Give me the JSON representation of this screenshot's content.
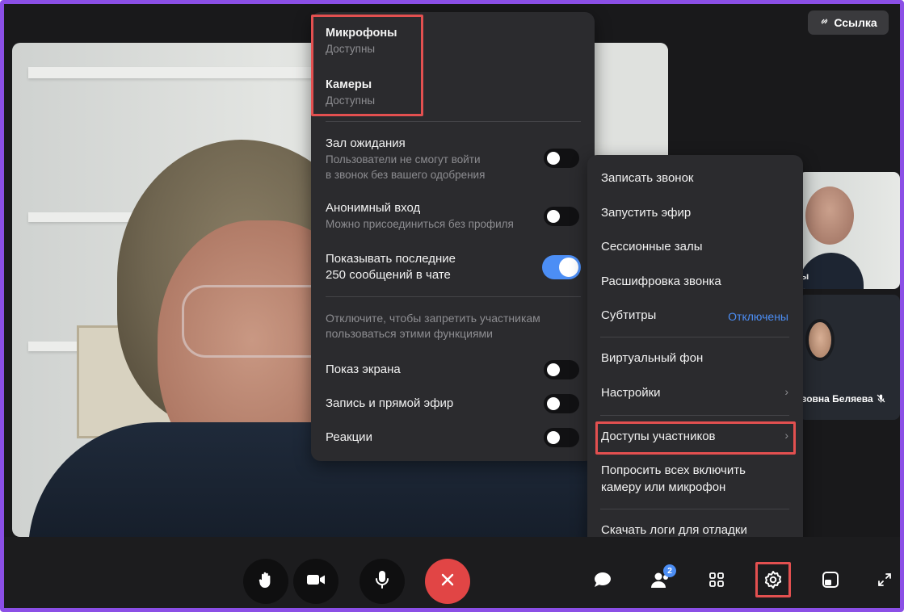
{
  "link_chip": {
    "icon": "link-icon",
    "label": "Ссылка"
  },
  "access_panel": {
    "microphones": {
      "title": "Микрофоны",
      "status": "Доступны"
    },
    "cameras": {
      "title": "Камеры",
      "status": "Доступны"
    },
    "waiting_room": {
      "title": "Зал ожидания",
      "desc_line1": "Пользователи не смогут войти",
      "desc_line2": "в звонок без вашего одобрения",
      "enabled": false
    },
    "anonymous_entry": {
      "title": "Анонимный вход",
      "desc": "Можно присоединиться без профиля",
      "enabled": false
    },
    "show_last_messages": {
      "line1": "Показывать последние",
      "line2": "250 сообщений в чате",
      "enabled": true
    },
    "restrict_note": {
      "line1": "Отключите, чтобы запретить участникам",
      "line2": "пользоваться этими функциями"
    },
    "screen_share": {
      "label": "Показ экрана",
      "enabled": false
    },
    "recording": {
      "label": "Запись и прямой эфир",
      "enabled": false
    },
    "reactions": {
      "label": "Реакции",
      "enabled": false
    }
  },
  "settings_menu": {
    "record_call": "Записать звонок",
    "start_stream": "Запустить эфир",
    "session_rooms": "Сессионные залы",
    "transcription": "Расшифровка звонка",
    "subtitles": {
      "label": "Субтитры",
      "value": "Отключены"
    },
    "virtual_bg": "Виртуальный фон",
    "settings": "Настройки",
    "participant_access": "Доступы участников",
    "ask_enable_line1": "Попросить всех включить",
    "ask_enable_line2": "камеру или микрофон",
    "download_logs": "Скачать логи для отладки"
  },
  "tiles": {
    "tile1_name_fragment": "ы",
    "tile2_name": "вовна Беляева"
  },
  "toolbar": {
    "participants_badge": "2",
    "icons": [
      "raise-hand-icon",
      "camera-icon",
      "microphone-icon",
      "end-call-icon",
      "chat-icon",
      "participants-icon",
      "grid-icon",
      "settings-icon",
      "layout-icon",
      "fullscreen-icon"
    ]
  },
  "colors": {
    "accent": "#4c8ef5",
    "highlight": "#e35050",
    "frame": "#8b4fe6",
    "end_call": "#e14545"
  }
}
